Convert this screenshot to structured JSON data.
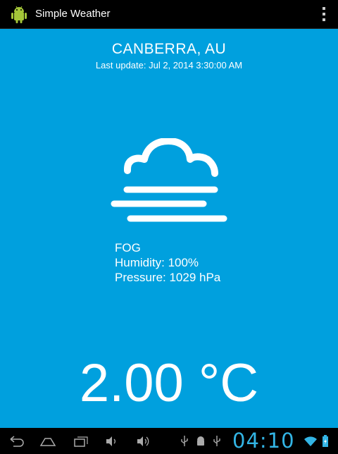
{
  "app": {
    "title": "Simple Weather"
  },
  "location": {
    "city": "CANBERRA, AU",
    "last_update": "Last update: Jul 2, 2014 3:30:00 AM"
  },
  "weather": {
    "condition": "FOG",
    "humidity": "Humidity: 100%",
    "pressure": "Pressure: 1029 hPa",
    "temperature": "2.00 °C",
    "icon": "fog-icon"
  },
  "status_bar": {
    "clock": "04:10"
  },
  "colors": {
    "background": "#00a0de",
    "clock": "#33b5e5"
  }
}
